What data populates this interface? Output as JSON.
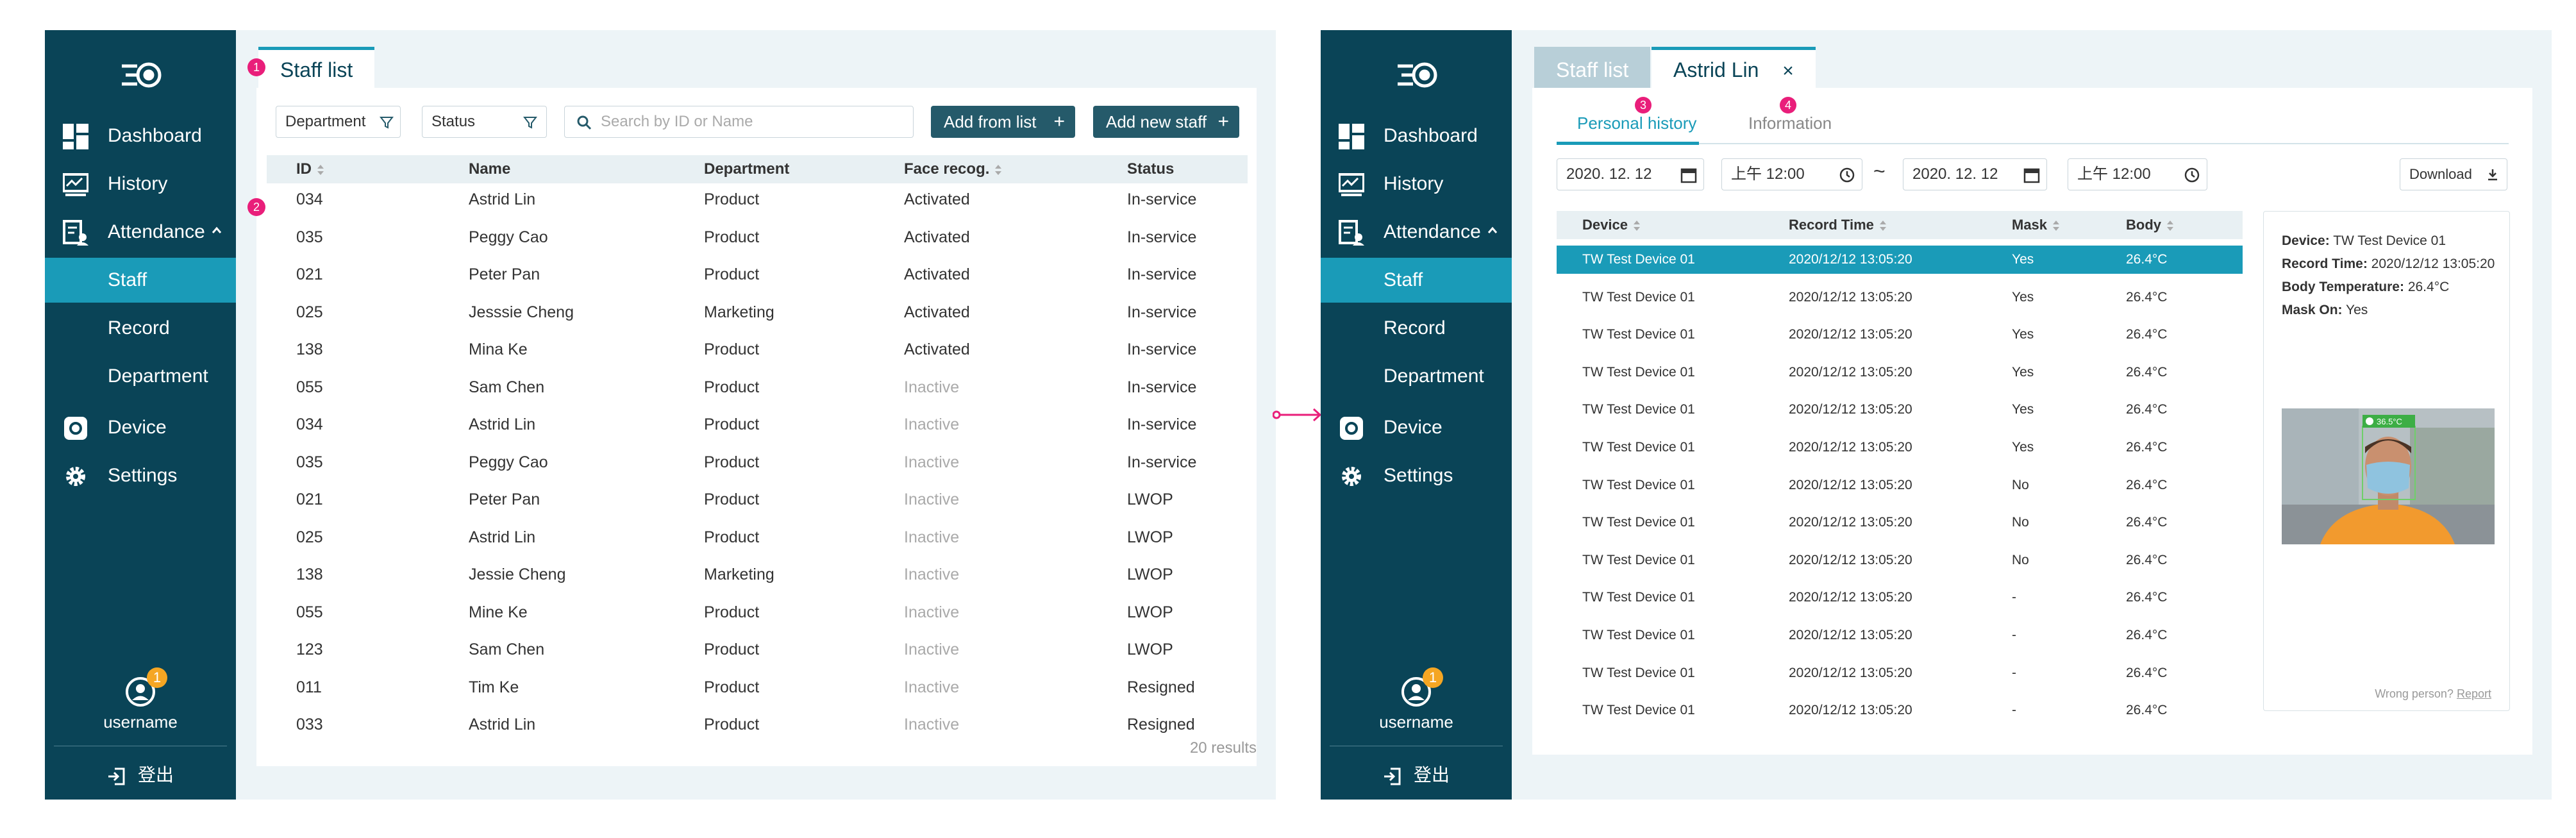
{
  "nav": {
    "dashboard": "Dashboard",
    "history": "History",
    "attendance": "Attendance",
    "staff": "Staff",
    "record": "Record",
    "department": "Department",
    "device": "Device",
    "settings": "Settings",
    "username": "username",
    "notification_count": "1",
    "logout": "登出"
  },
  "left": {
    "tab": "Staff list",
    "department_filter": "Department",
    "status_filter": "Status",
    "search_placeholder": "Search by ID or Name",
    "add_from_list": "Add from list",
    "add_new_staff": "Add new staff",
    "columns": [
      "ID",
      "Name",
      "Department",
      "Face recog.",
      "Status"
    ],
    "rows": [
      [
        "034",
        "Astrid Lin",
        "Product",
        "Activated",
        "In-service"
      ],
      [
        "035",
        "Peggy Cao",
        "Product",
        "Activated",
        "In-service"
      ],
      [
        "021",
        "Peter Pan",
        "Product",
        "Activated",
        "In-service"
      ],
      [
        "025",
        "Jesssie Cheng",
        "Marketing",
        "Activated",
        "In-service"
      ],
      [
        "138",
        "Mina Ke",
        "Product",
        "Activated",
        "In-service"
      ],
      [
        "055",
        "Sam Chen",
        "Product",
        "Inactive",
        "In-service"
      ],
      [
        "034",
        "Astrid Lin",
        "Product",
        "Inactive",
        "In-service"
      ],
      [
        "035",
        "Peggy Cao",
        "Product",
        "Inactive",
        "In-service"
      ],
      [
        "021",
        "Peter Pan",
        "Product",
        "Inactive",
        "LWOP"
      ],
      [
        "025",
        "Astrid Lin",
        "Product",
        "Inactive",
        "LWOP"
      ],
      [
        "138",
        "Jessie Cheng",
        "Marketing",
        "Inactive",
        "LWOP"
      ],
      [
        "055",
        "Mine Ke",
        "Product",
        "Inactive",
        "LWOP"
      ],
      [
        "123",
        "Sam Chen",
        "Product",
        "Inactive",
        "LWOP"
      ],
      [
        "011",
        "Tim Ke",
        "Product",
        "Inactive",
        "Resigned"
      ],
      [
        "033",
        "Astrid Lin",
        "Product",
        "Inactive",
        "Resigned"
      ]
    ],
    "results": "20 results",
    "markers": [
      "1",
      "2"
    ]
  },
  "right": {
    "tab_staff_list": "Staff list",
    "tab_person": "Astrid Lin",
    "tab_close": "×",
    "subtab_history": "Personal history",
    "subtab_information": "Information",
    "markers": [
      "3",
      "4"
    ],
    "date_from": "2020. 12. 12",
    "time_from": "上午 12:00",
    "tilde": "~",
    "date_to": "2020. 12. 12",
    "time_to": "上午 12:00",
    "download": "Download",
    "columns": [
      "Device",
      "Record Time",
      "Mask",
      "Body"
    ],
    "rows": [
      [
        "TW Test Device 01",
        "2020/12/12 13:05:20",
        "Yes",
        "26.4°C"
      ],
      [
        "TW Test Device 01",
        "2020/12/12 13:05:20",
        "Yes",
        "26.4°C"
      ],
      [
        "TW Test Device 01",
        "2020/12/12 13:05:20",
        "Yes",
        "26.4°C"
      ],
      [
        "TW Test Device 01",
        "2020/12/12 13:05:20",
        "Yes",
        "26.4°C"
      ],
      [
        "TW Test Device 01",
        "2020/12/12 13:05:20",
        "Yes",
        "26.4°C"
      ],
      [
        "TW Test Device 01",
        "2020/12/12 13:05:20",
        "Yes",
        "26.4°C"
      ],
      [
        "TW Test Device 01",
        "2020/12/12 13:05:20",
        "No",
        "26.4°C"
      ],
      [
        "TW Test Device 01",
        "2020/12/12 13:05:20",
        "No",
        "26.4°C"
      ],
      [
        "TW Test Device 01",
        "2020/12/12 13:05:20",
        "No",
        "26.4°C"
      ],
      [
        "TW Test Device 01",
        "2020/12/12 13:05:20",
        "-",
        "26.4°C"
      ],
      [
        "TW Test Device 01",
        "2020/12/12 13:05:20",
        "-",
        "26.4°C"
      ],
      [
        "TW Test Device 01",
        "2020/12/12 13:05:20",
        "-",
        "26.4°C"
      ],
      [
        "TW Test Device 01",
        "2020/12/12 13:05:20",
        "-",
        "26.4°C"
      ]
    ],
    "detail": {
      "device_label": "Device:",
      "device_value": "TW Test Device 01",
      "time_label": "Record Time:",
      "time_value": "2020/12/12 13:05:20",
      "temp_label": "Body Temperature:",
      "temp_value": "26.4°C",
      "mask_label": "Mask On:",
      "mask_value": "Yes",
      "photo_temp": "36.5°C",
      "wrong_person": "Wrong person?",
      "report": "Report"
    }
  },
  "colors": {
    "sidebar": "#0a4457",
    "accent": "#1a9bb8",
    "marker": "#e91e7a",
    "badge": "#f5a623"
  }
}
